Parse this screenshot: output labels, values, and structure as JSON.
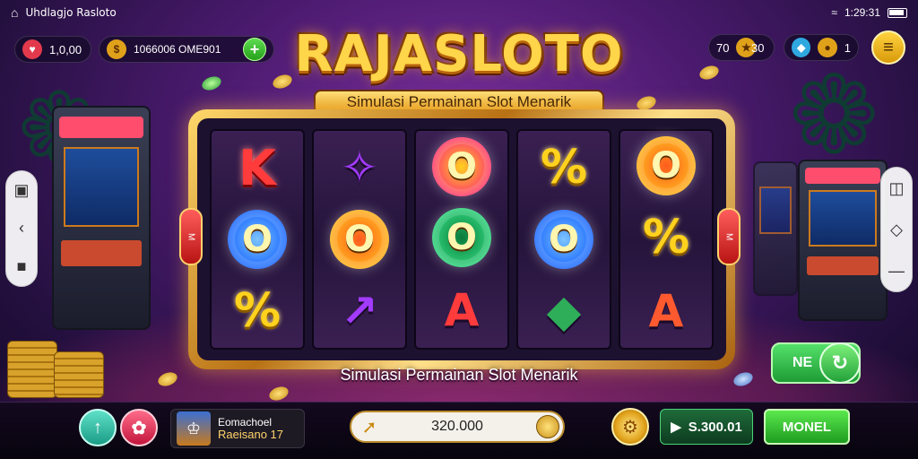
{
  "status_bar": {
    "app_name": "Uhdlagjo Rasloto",
    "time": "1:29:31"
  },
  "hud_left": {
    "lives": "1,0,00",
    "coins": "1066006 OME901"
  },
  "hud_right": {
    "value_a": "70",
    "value_b": "30",
    "value_c": "1"
  },
  "game": {
    "title": "RAJASLOTO",
    "subtitle": "Simulasi Permainan Slot Menarik",
    "side_tab_left": "M",
    "side_tab_right": "M"
  },
  "reels": [
    [
      "K",
      "O",
      "%"
    ],
    [
      "✧",
      "O",
      "↗"
    ],
    [
      "O",
      "O",
      "A"
    ],
    [
      "%",
      "O",
      "◆"
    ],
    [
      "O",
      "%",
      "A"
    ]
  ],
  "next_button": {
    "label": "NE"
  },
  "bottom": {
    "info_line1": "Eomachoel",
    "info_line2": "Raeisano 17",
    "bet_value": "320.000",
    "spin_value": "S.300.01",
    "play_label": "MONEL"
  },
  "colors": {
    "gold": "#ffd54a",
    "purple": "#4a1a6e",
    "green": "#25a11a"
  }
}
